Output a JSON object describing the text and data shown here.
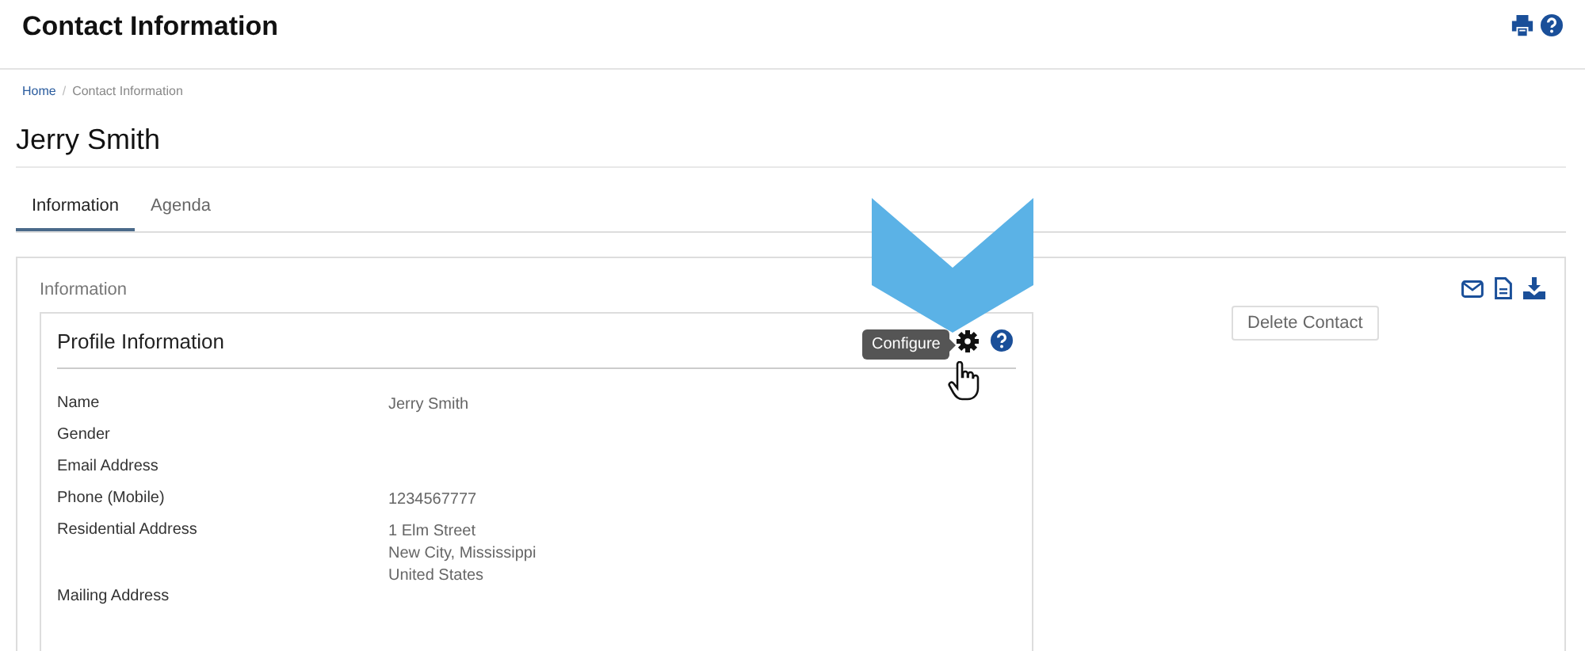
{
  "header": {
    "title": "Contact Information"
  },
  "breadcrumb": {
    "separator": "/",
    "items": [
      {
        "label": "Home",
        "kind": "link"
      },
      {
        "label": "Contact Information",
        "kind": "current"
      }
    ]
  },
  "contact_name": "Jerry Smith",
  "tabs": [
    {
      "label": "Information",
      "selected": true
    },
    {
      "label": "Agenda",
      "selected": false
    }
  ],
  "panel": {
    "title": "Information",
    "delete_button": "Delete Contact"
  },
  "profile": {
    "title": "Profile Information",
    "tooltip": "Configure",
    "fields": [
      {
        "label": "Name",
        "value": [
          "Jerry Smith"
        ]
      },
      {
        "label": "Gender"
      },
      {
        "label": "Email Address"
      },
      {
        "label": "Phone (Mobile)",
        "value": [
          "1234567777"
        ]
      },
      {
        "label": "Residential Address",
        "value": [
          "1 Elm Street",
          "New City, Mississippi",
          "United States"
        ]
      },
      {
        "label": "Mailing Address"
      }
    ]
  }
}
